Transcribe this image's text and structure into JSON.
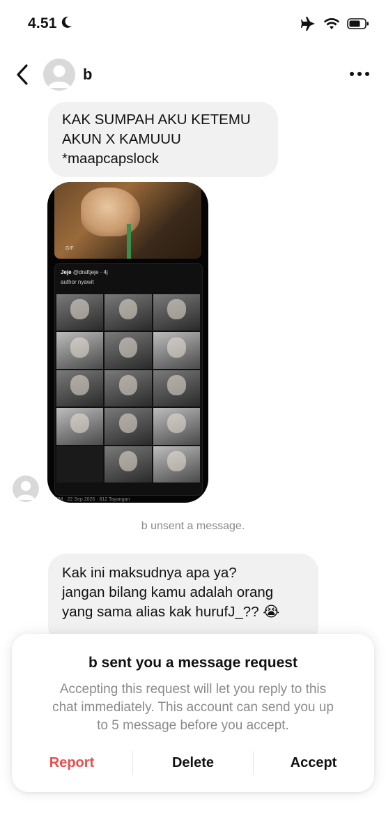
{
  "status_bar": {
    "time": "4.51"
  },
  "header": {
    "name": "b",
    "back_icon": "chevron-left-icon",
    "more_icon": "more-horizontal-icon"
  },
  "messages": [
    {
      "lines": [
        "KAK SUMPAH AKU KETEMU",
        "AKUN X KAMUUU",
        "*maapcapslock"
      ]
    },
    {
      "lines": [
        "Kak ini maksudnya apa ya?",
        "jangan bilang kamu adalah orang",
        "yang sama alias kak hurufJ_?? 😭"
      ]
    }
  ],
  "shared_image": {
    "gif_label": "GIF",
    "user": "Jeje",
    "handle": "@draftjeje · 4j",
    "text": "author nyawit",
    "footer": "4 PM · 22 Sep 2026 · 812 Tayangan"
  },
  "system_notice": "b unsent a message.",
  "request_sheet": {
    "title": "b sent you a message request",
    "body_lines": [
      "Accepting this request will let you reply to this",
      "chat immediately. This account can send you up",
      "to 5 message before you accept."
    ],
    "report_label": "Report",
    "delete_label": "Delete",
    "accept_label": "Accept"
  },
  "colors": {
    "report": "#ee4b4b",
    "bubble": "#f1f1f2",
    "muted": "#8a8a8a"
  }
}
